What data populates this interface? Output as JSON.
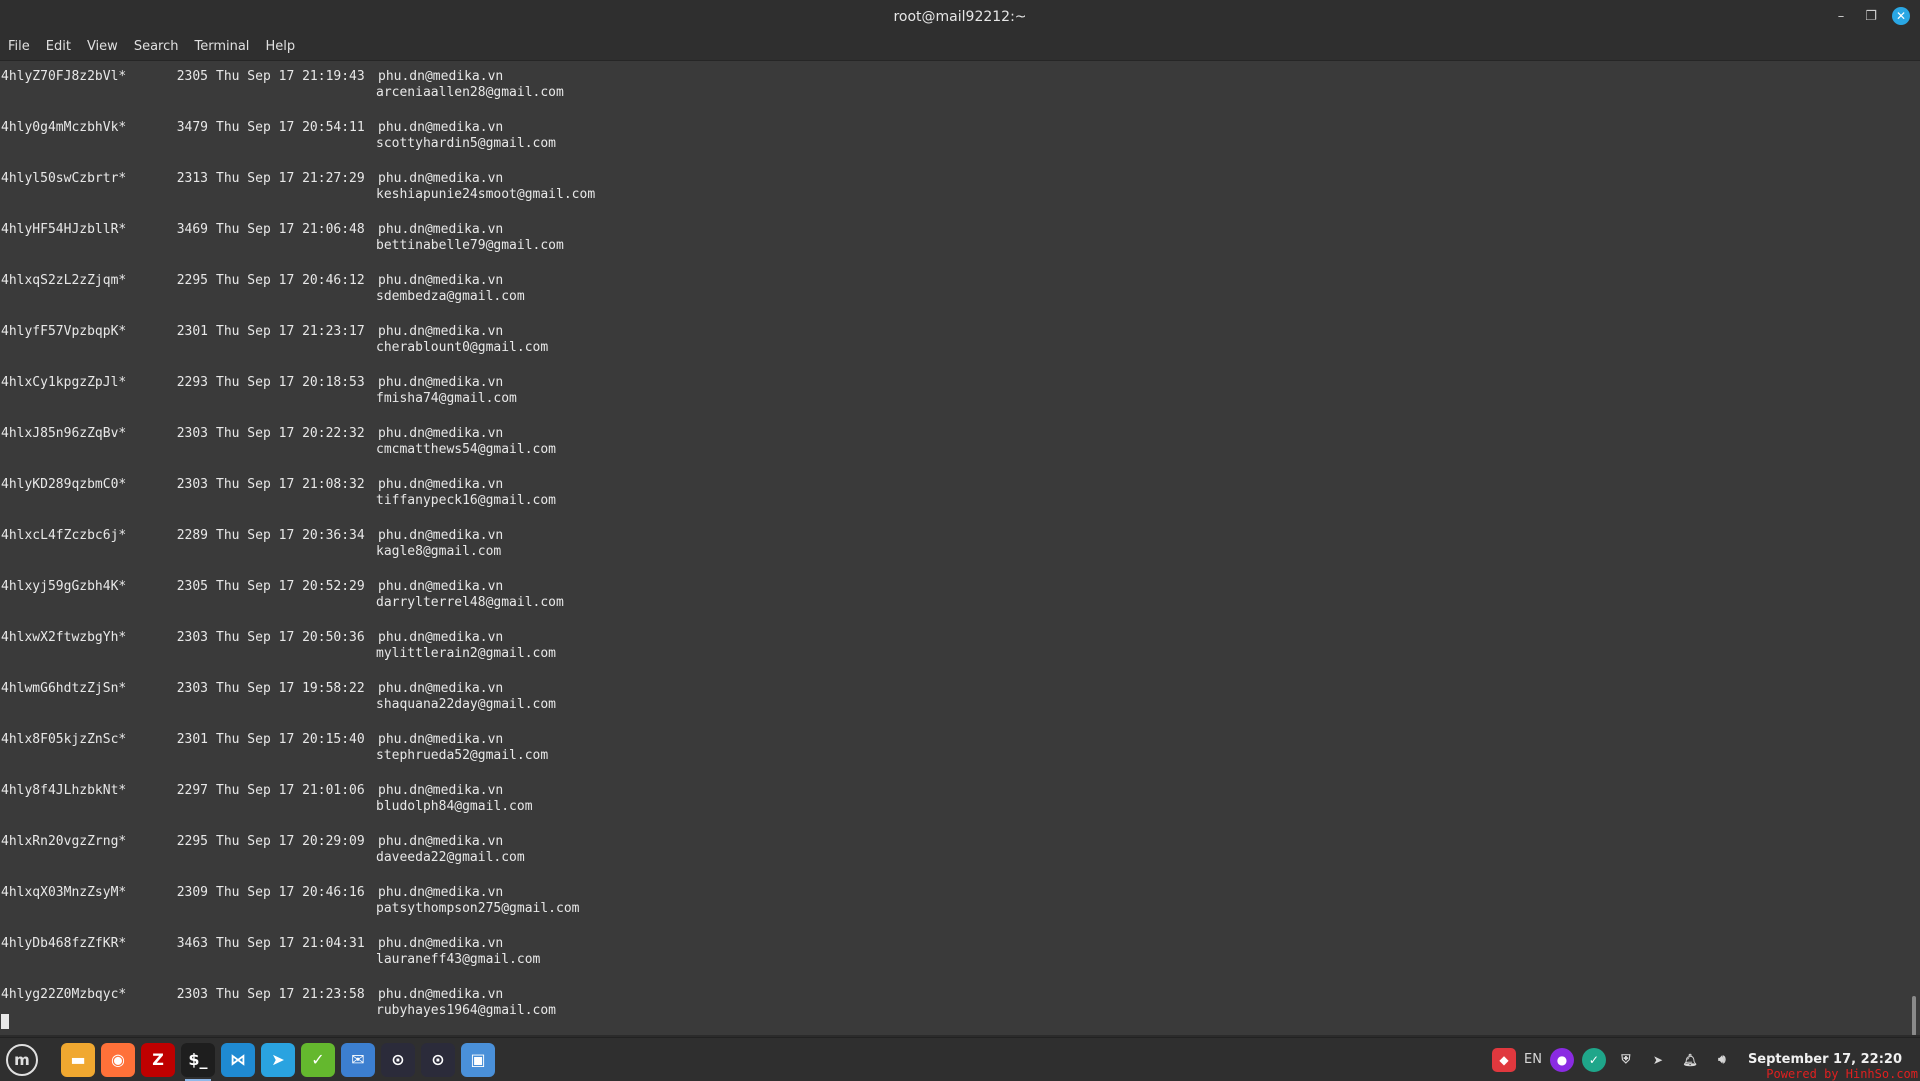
{
  "window": {
    "title": "root@mail92212:~"
  },
  "menu": [
    "File",
    "Edit",
    "View",
    "Search",
    "Terminal",
    "Help"
  ],
  "terminal": {
    "entries": [
      {
        "id": "4hlyZ70FJ8z2bVl*",
        "size": "2305",
        "date": "Thu Sep 17 21:19:43",
        "sender": "phu.dn@medika.vn",
        "recipient": "arceniaallen28@gmail.com"
      },
      {
        "id": "4hly0g4mMczbhVk*",
        "size": "3479",
        "date": "Thu Sep 17 20:54:11",
        "sender": "phu.dn@medika.vn",
        "recipient": "scottyhardin5@gmail.com"
      },
      {
        "id": "4hlyl50swCzbrtr*",
        "size": "2313",
        "date": "Thu Sep 17 21:27:29",
        "sender": "phu.dn@medika.vn",
        "recipient": "keshiapunie24smoot@gmail.com"
      },
      {
        "id": "4hlyHF54HJzbllR*",
        "size": "3469",
        "date": "Thu Sep 17 21:06:48",
        "sender": "phu.dn@medika.vn",
        "recipient": "bettinabelle79@gmail.com"
      },
      {
        "id": "4hlxqS2zL2zZjqm*",
        "size": "2295",
        "date": "Thu Sep 17 20:46:12",
        "sender": "phu.dn@medika.vn",
        "recipient": "sdembedza@gmail.com"
      },
      {
        "id": "4hlyfF57VpzbqpK*",
        "size": "2301",
        "date": "Thu Sep 17 21:23:17",
        "sender": "phu.dn@medika.vn",
        "recipient": "cherablount0@gmail.com"
      },
      {
        "id": "4hlxCy1kpgzZpJl*",
        "size": "2293",
        "date": "Thu Sep 17 20:18:53",
        "sender": "phu.dn@medika.vn",
        "recipient": "fmisha74@gmail.com"
      },
      {
        "id": "4hlxJ85n96zZqBv*",
        "size": "2303",
        "date": "Thu Sep 17 20:22:32",
        "sender": "phu.dn@medika.vn",
        "recipient": "cmcmatthews54@gmail.com"
      },
      {
        "id": "4hlyKD289qzbmC0*",
        "size": "2303",
        "date": "Thu Sep 17 21:08:32",
        "sender": "phu.dn@medika.vn",
        "recipient": "tiffanypeck16@gmail.com"
      },
      {
        "id": "4hlxcL4fZczbc6j*",
        "size": "2289",
        "date": "Thu Sep 17 20:36:34",
        "sender": "phu.dn@medika.vn",
        "recipient": "kagle8@gmail.com"
      },
      {
        "id": "4hlxyj59gGzbh4K*",
        "size": "2305",
        "date": "Thu Sep 17 20:52:29",
        "sender": "phu.dn@medika.vn",
        "recipient": "darrylterrel48@gmail.com"
      },
      {
        "id": "4hlxwX2ftwzbgYh*",
        "size": "2303",
        "date": "Thu Sep 17 20:50:36",
        "sender": "phu.dn@medika.vn",
        "recipient": "mylittlerain2@gmail.com"
      },
      {
        "id": "4hlwmG6hdtzZjSn*",
        "size": "2303",
        "date": "Thu Sep 17 19:58:22",
        "sender": "phu.dn@medika.vn",
        "recipient": "shaquana22day@gmail.com"
      },
      {
        "id": "4hlx8F05kjzZnSc*",
        "size": "2301",
        "date": "Thu Sep 17 20:15:40",
        "sender": "phu.dn@medika.vn",
        "recipient": "stephrueda52@gmail.com"
      },
      {
        "id": "4hly8f4JLhzbkNt*",
        "size": "2297",
        "date": "Thu Sep 17 21:01:06",
        "sender": "phu.dn@medika.vn",
        "recipient": "bludolph84@gmail.com"
      },
      {
        "id": "4hlxRn20vgzZrng*",
        "size": "2295",
        "date": "Thu Sep 17 20:29:09",
        "sender": "phu.dn@medika.vn",
        "recipient": "daveeda22@gmail.com"
      },
      {
        "id": "4hlxqX03MnzZsyM*",
        "size": "2309",
        "date": "Thu Sep 17 20:46:16",
        "sender": "phu.dn@medika.vn",
        "recipient": "patsythompson275@gmail.com"
      },
      {
        "id": "4hlyDb468fzZfKR*",
        "size": "3463",
        "date": "Thu Sep 17 21:04:31",
        "sender": "phu.dn@medika.vn",
        "recipient": "lauraneff43@gmail.com"
      },
      {
        "id": "4hlyg22Z0Mzbqyc*",
        "size": "2303",
        "date": "Thu Sep 17 21:23:58",
        "sender": "phu.dn@medika.vn",
        "recipient": "rubyhayes1964@gmail.com"
      }
    ]
  },
  "taskbar": {
    "start_icon": "linux-mint-menu-icon",
    "apps": [
      {
        "name": "files-icon",
        "color": "#f0a830",
        "glyph": "▬"
      },
      {
        "name": "firefox-icon",
        "color": "#ff7139",
        "glyph": "◉"
      },
      {
        "name": "filezilla-icon",
        "color": "#bf0000",
        "glyph": "Z"
      },
      {
        "name": "terminal-icon",
        "color": "#1e1e1e",
        "glyph": "$_"
      },
      {
        "name": "vscode-icon",
        "color": "#1f8ad2",
        "glyph": "⋈"
      },
      {
        "name": "telegram-icon",
        "color": "#2aa3e0",
        "glyph": "➤"
      },
      {
        "name": "chat-app-icon",
        "color": "#64b82e",
        "glyph": "✓"
      },
      {
        "name": "mail-icon",
        "color": "#3c7fd0",
        "glyph": "✉"
      },
      {
        "name": "app-icon",
        "color": "#2b2b3a",
        "glyph": "⊙"
      },
      {
        "name": "app-icon-2",
        "color": "#2b2b3a",
        "glyph": "⊙"
      },
      {
        "name": "remote-desktop-icon",
        "color": "#4a90d9",
        "glyph": "▣"
      }
    ],
    "tray": {
      "lang": "EN",
      "clock": "September 17, 22:20"
    },
    "watermark": "Powered by HinhSo.com"
  },
  "colors": {
    "terminal_bg": "#3a3a3a",
    "text": "#e8e8e8",
    "accent": "#2aa7e4"
  }
}
